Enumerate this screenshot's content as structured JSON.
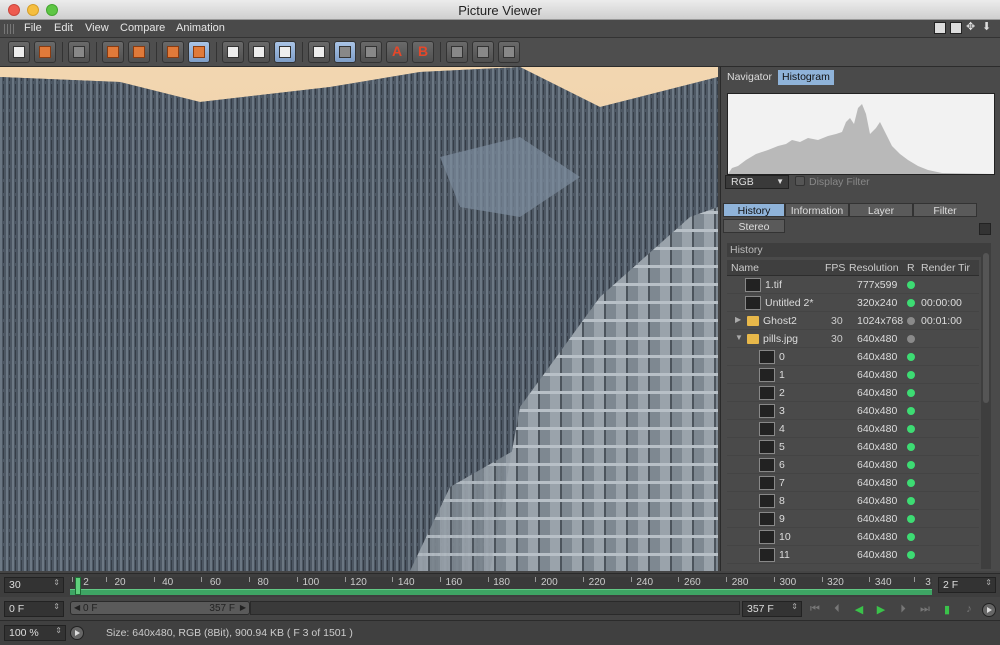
{
  "window": {
    "title": "Picture Viewer"
  },
  "menu": [
    "File",
    "Edit",
    "View",
    "Compare",
    "Animation"
  ],
  "toolbar": {
    "buttons": [
      "open-icon",
      "save-icon",
      "filter-icon",
      "export-icon",
      "layers-icon",
      "snapshot-icon",
      "render-region-icon",
      "render-icon",
      "render-all-icon",
      "compare-icon",
      "ab-split-icon",
      "ab-mode-icon",
      "set-a-icon",
      "set-b-icon",
      "split-vertical-icon",
      "split-horizontal-icon",
      "split-both-icon"
    ],
    "set_a_label": "A",
    "set_b_label": "B"
  },
  "panel": {
    "tabs": {
      "navigator": "Navigator",
      "histogram": "Histogram"
    },
    "channel_select": "RGB",
    "display_filter": "Display Filter",
    "subtabs": {
      "history": "History",
      "information": "Information",
      "layer": "Layer",
      "filter": "Filter",
      "stereo": "Stereo"
    },
    "section_label": "History",
    "columns": {
      "name": "Name",
      "fps": "FPS",
      "resolution": "Resolution",
      "r": "R",
      "render_time": "Render Tir"
    },
    "rows": [
      {
        "name": "1.tif",
        "fps": "",
        "res": "777x599",
        "status": "green",
        "time": ""
      },
      {
        "name": "Untitled 2*",
        "fps": "",
        "res": "320x240",
        "status": "green",
        "time": "00:00:00"
      },
      {
        "name": "Ghost2",
        "fps": "30",
        "res": "1024x768",
        "status": "gray",
        "time": "00:01:00"
      },
      {
        "name": "pills.jpg",
        "fps": "30",
        "res": "640x480",
        "status": "gray",
        "time": ""
      },
      {
        "name": "0",
        "fps": "",
        "res": "640x480",
        "status": "green",
        "time": ""
      },
      {
        "name": "1",
        "fps": "",
        "res": "640x480",
        "status": "green",
        "time": ""
      },
      {
        "name": "2",
        "fps": "",
        "res": "640x480",
        "status": "green",
        "time": ""
      },
      {
        "name": "3",
        "fps": "",
        "res": "640x480",
        "status": "green",
        "time": ""
      },
      {
        "name": "4",
        "fps": "",
        "res": "640x480",
        "status": "green",
        "time": ""
      },
      {
        "name": "5",
        "fps": "",
        "res": "640x480",
        "status": "green",
        "time": ""
      },
      {
        "name": "6",
        "fps": "",
        "res": "640x480",
        "status": "green",
        "time": ""
      },
      {
        "name": "7",
        "fps": "",
        "res": "640x480",
        "status": "green",
        "time": ""
      },
      {
        "name": "8",
        "fps": "",
        "res": "640x480",
        "status": "green",
        "time": ""
      },
      {
        "name": "9",
        "fps": "",
        "res": "640x480",
        "status": "green",
        "time": ""
      },
      {
        "name": "10",
        "fps": "",
        "res": "640x480",
        "status": "green",
        "time": ""
      },
      {
        "name": "11",
        "fps": "",
        "res": "640x480",
        "status": "green",
        "time": ""
      }
    ]
  },
  "timeline": {
    "fps_value": "30",
    "ruler_labels": [
      "2",
      "20",
      "40",
      "60",
      "80",
      "100",
      "120",
      "140",
      "160",
      "180",
      "200",
      "220",
      "240",
      "260",
      "280",
      "300",
      "320",
      "340",
      "3"
    ],
    "frame_step": "2 F",
    "start_value": "0 F",
    "range_start": "0 F",
    "range_end": "357 F",
    "end_value": "357 F"
  },
  "status": {
    "zoom": "100 %",
    "info": "Size: 640x480, RGB (8Bit), 900.94 KB ( F 3  of  1501 )"
  },
  "colors": {
    "accent": "#8fb3d9",
    "status_green": "#3ddc73",
    "status_gray": "#8a8a8a",
    "timeline_green": "#3ea564"
  }
}
